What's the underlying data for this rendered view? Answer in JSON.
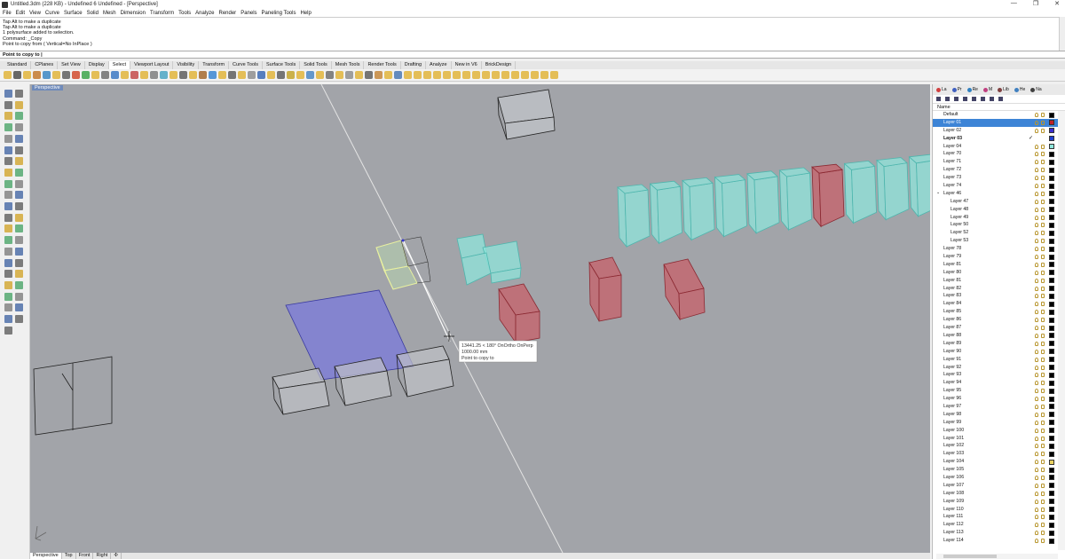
{
  "window": {
    "title": "Untitled.3dm (228 KB) - Undefined 6 Undefined - [Perspective]",
    "controls": [
      "—",
      "❐",
      "✕"
    ]
  },
  "menu": [
    "File",
    "Edit",
    "View",
    "Curve",
    "Surface",
    "Solid",
    "Mesh",
    "Dimension",
    "Transform",
    "Tools",
    "Analyze",
    "Render",
    "Panels",
    "Paneling Tools",
    "Help"
  ],
  "command_history": [
    "Tap Alt to make a duplicate",
    "Tap Alt to make a duplicate",
    "1 polysurface added to selection.",
    "Command: _Copy",
    "Point to copy from ( Vertical=No  InPlace )"
  ],
  "command_prompt": "Point to copy to",
  "toolbar_tabs": [
    "Standard",
    "CPlanes",
    "Set View",
    "Display",
    "Select",
    "Viewport Layout",
    "Visibility",
    "Transform",
    "Curve Tools",
    "Surface Tools",
    "Solid Tools",
    "Mesh Tools",
    "Render Tools",
    "Drafting",
    "Analyze",
    "New in V6",
    "BrickDesign"
  ],
  "active_toolbar_tab": "Select",
  "viewport": {
    "label": "Perspective",
    "tooltip": [
      "13441.25 < 180° OnOrtho OnPerp",
      "1000.00 mm",
      "Point to copy to"
    ]
  },
  "viewport_tabs": [
    "Perspective",
    "Top",
    "Front",
    "Right",
    "✣"
  ],
  "panel": {
    "tabs": [
      "La",
      "Pr",
      "Re",
      "M",
      "Lib",
      "He",
      "Na"
    ],
    "column_header": "Name",
    "layers": [
      {
        "name": "Default",
        "indent": 0,
        "color": "#000000"
      },
      {
        "name": "Layer 01",
        "indent": 0,
        "color": "#c0202a",
        "selected": true
      },
      {
        "name": "Layer 02",
        "indent": 0,
        "color": "#3b2ecf"
      },
      {
        "name": "Layer 03",
        "indent": 0,
        "color": "#1f3fcf",
        "current": true,
        "bold": true
      },
      {
        "name": "Layer 04",
        "indent": 0,
        "color": "#8fe6dc"
      },
      {
        "name": "Layer 70",
        "indent": 0,
        "color": "#000000"
      },
      {
        "name": "Layer 71",
        "indent": 0,
        "color": "#000000"
      },
      {
        "name": "Layer 72",
        "indent": 0,
        "color": "#000000"
      },
      {
        "name": "Layer 73",
        "indent": 0,
        "color": "#000000"
      },
      {
        "name": "Layer 74",
        "indent": 0,
        "color": "#000000"
      },
      {
        "name": "Layer 46",
        "indent": 0,
        "color": "#000000",
        "expanded": true
      },
      {
        "name": "Layer 47",
        "indent": 1,
        "color": "#000000"
      },
      {
        "name": "Layer 48",
        "indent": 1,
        "color": "#000000"
      },
      {
        "name": "Layer 49",
        "indent": 1,
        "color": "#000000"
      },
      {
        "name": "Layer 50",
        "indent": 1,
        "color": "#000000"
      },
      {
        "name": "Layer 52",
        "indent": 1,
        "color": "#000000"
      },
      {
        "name": "Layer 53",
        "indent": 1,
        "color": "#000000"
      },
      {
        "name": "Layer 78",
        "indent": 0,
        "color": "#000000"
      },
      {
        "name": "Layer 79",
        "indent": 0,
        "color": "#000000"
      },
      {
        "name": "Layer 81",
        "indent": 0,
        "color": "#000000"
      },
      {
        "name": "Layer 80",
        "indent": 0,
        "color": "#000000"
      },
      {
        "name": "Layer 81",
        "indent": 0,
        "color": "#000000"
      },
      {
        "name": "Layer 82",
        "indent": 0,
        "color": "#000000"
      },
      {
        "name": "Layer 83",
        "indent": 0,
        "color": "#000000"
      },
      {
        "name": "Layer 84",
        "indent": 0,
        "color": "#000000"
      },
      {
        "name": "Layer 85",
        "indent": 0,
        "color": "#000000"
      },
      {
        "name": "Layer 86",
        "indent": 0,
        "color": "#000000"
      },
      {
        "name": "Layer 87",
        "indent": 0,
        "color": "#000000"
      },
      {
        "name": "Layer 88",
        "indent": 0,
        "color": "#000000"
      },
      {
        "name": "Layer 89",
        "indent": 0,
        "color": "#000000"
      },
      {
        "name": "Layer 90",
        "indent": 0,
        "color": "#000000"
      },
      {
        "name": "Layer 91",
        "indent": 0,
        "color": "#000000"
      },
      {
        "name": "Layer 92",
        "indent": 0,
        "color": "#000000"
      },
      {
        "name": "Layer 93",
        "indent": 0,
        "color": "#000000"
      },
      {
        "name": "Layer 94",
        "indent": 0,
        "color": "#000000"
      },
      {
        "name": "Layer 95",
        "indent": 0,
        "color": "#000000"
      },
      {
        "name": "Layer 96",
        "indent": 0,
        "color": "#000000"
      },
      {
        "name": "Layer 97",
        "indent": 0,
        "color": "#000000"
      },
      {
        "name": "Layer 98",
        "indent": 0,
        "color": "#000000"
      },
      {
        "name": "Layer 99",
        "indent": 0,
        "color": "#000000"
      },
      {
        "name": "Layer 100",
        "indent": 0,
        "color": "#000000"
      },
      {
        "name": "Layer 101",
        "indent": 0,
        "color": "#000000"
      },
      {
        "name": "Layer 102",
        "indent": 0,
        "color": "#000000"
      },
      {
        "name": "Layer 103",
        "indent": 0,
        "color": "#000000"
      },
      {
        "name": "Layer 104",
        "indent": 0,
        "color": "#e8d060"
      },
      {
        "name": "Layer 105",
        "indent": 0,
        "color": "#000000"
      },
      {
        "name": "Layer 106",
        "indent": 0,
        "color": "#000000"
      },
      {
        "name": "Layer 107",
        "indent": 0,
        "color": "#000000"
      },
      {
        "name": "Layer 108",
        "indent": 0,
        "color": "#000000"
      },
      {
        "name": "Layer 109",
        "indent": 0,
        "color": "#000000"
      },
      {
        "name": "Layer 110",
        "indent": 0,
        "color": "#000000"
      },
      {
        "name": "Layer 111",
        "indent": 0,
        "color": "#000000"
      },
      {
        "name": "Layer 112",
        "indent": 0,
        "color": "#000000"
      },
      {
        "name": "Layer 113",
        "indent": 0,
        "color": "#000000"
      },
      {
        "name": "Layer 114",
        "indent": 0,
        "color": "#000000"
      }
    ]
  },
  "colors": {
    "viewport_bg": "#a2a4a9",
    "cyan_box": "#8fe6dc",
    "red_box": "#c7606a",
    "blue_plane": "#7f7fd6"
  }
}
